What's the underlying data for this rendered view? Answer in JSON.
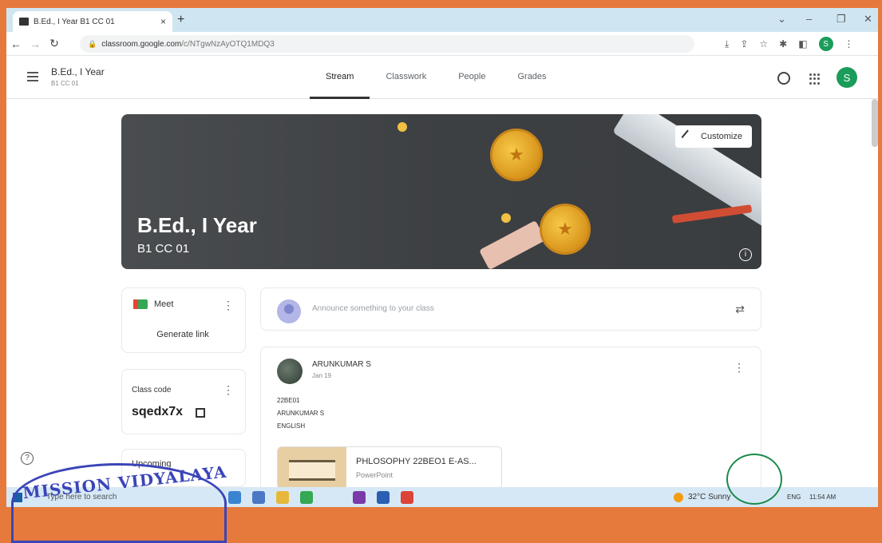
{
  "browser": {
    "tab_title": "B.Ed., I Year B1 CC 01",
    "url_host": "classroom.google.com",
    "url_path": "/c/NTgwNzAyOTQ1MDQ3",
    "profile_initial": "S"
  },
  "header": {
    "class_name": "B.Ed., I Year",
    "section": "B1 CC 01",
    "tabs": [
      {
        "label": "Stream"
      },
      {
        "label": "Classwork"
      },
      {
        "label": "People"
      },
      {
        "label": "Grades"
      }
    ],
    "avatar_initial": "S"
  },
  "banner": {
    "title": "B.Ed., I Year",
    "subtitle": "B1 CC 01",
    "customize_label": "Customize"
  },
  "meet": {
    "label": "Meet",
    "generate_label": "Generate link"
  },
  "class_code": {
    "label": "Class code",
    "value": "sqedx7x"
  },
  "upcoming": {
    "label": "Upcoming"
  },
  "announce": {
    "placeholder": "Announce something to your class"
  },
  "post": {
    "author": "ARUNKUMAR S",
    "date": "Jan 19",
    "lines": [
      "22BE01",
      "ARUNKUMAR S",
      "ENGLISH"
    ],
    "attachment_title": "PHLOSOPHY 22BEO1 E-AS...",
    "attachment_type": "PowerPoint"
  },
  "taskbar": {
    "search": "Type here to search",
    "weather": "32°C Sunny",
    "lang": "ENG",
    "time": "11:54 AM"
  },
  "stamp": {
    "text": "MISSION VIDYALAYA"
  }
}
